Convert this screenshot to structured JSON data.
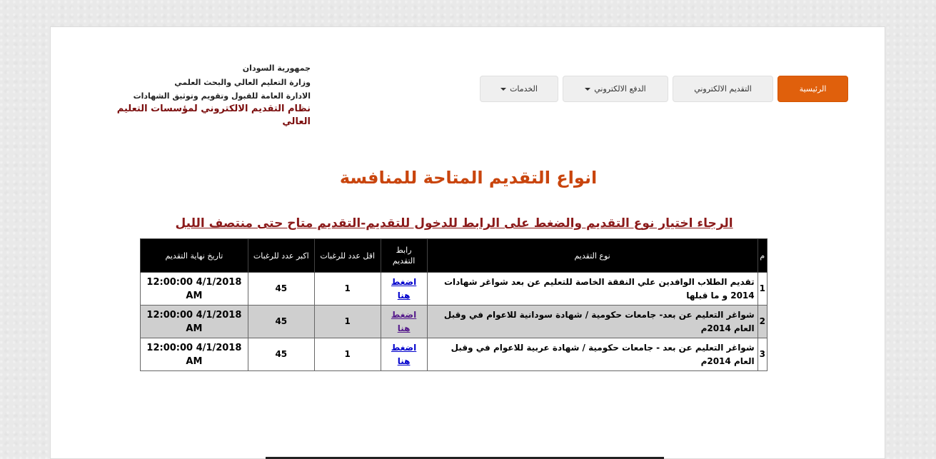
{
  "header": {
    "republic": "جمهورية السودان",
    "ministry": "وزارة التعليم العالي والبحث العلمي",
    "directorate": "الادارة العامة للقبول وتقويم وتوثيق الشهادات",
    "system_name": "نظام التقديم الالكتروني لمؤسسات التعليم العالي"
  },
  "nav": {
    "home": "الرئيسية",
    "apply_online": "التقديم الالكتروني",
    "pay_online": "الدفع الالكتروني",
    "services": "الخدمات"
  },
  "colors": {
    "accent": "#e0600c",
    "title": "#c9450d",
    "subtitle": "#8b1a1a",
    "system_name": "#7b0d0d"
  },
  "main": {
    "title": "انواع التقديم المتاحة للمنافسة",
    "instruction": "الرجاء اختيار نوع التقديم والضغط على الرابط للدخول للتقديم-التقديم متاح حتى منتصف الليل"
  },
  "table": {
    "headers": {
      "num": "م",
      "type": "نوع التقديم",
      "link": "رابط التقديم",
      "min": "اقل عدد للرغبات",
      "max": "اكبر عدد للرغبات",
      "deadline": "تاريخ نهاية التقديم"
    },
    "rows": [
      {
        "num": "1",
        "type": "تقديم الطلاب الوافدين علي النفقة الخاصة للتعليم عن بعد شواغر شهادات 2014 و ما قبلها",
        "link": "اضغط هنا",
        "min": "1",
        "max": "45",
        "deadline": "4/1/2018 12:00:00 AM"
      },
      {
        "num": "2",
        "type": "شواغر التعليم عن بعد- جامعات حكومية / شهادة سودانية للاعوام في وقبل العام 2014م",
        "link": "اضغط هنا",
        "min": "1",
        "max": "45",
        "deadline": "4/1/2018 12:00:00 AM"
      },
      {
        "num": "3",
        "type": "شواغر التعليم عن بعد - جامعات حكومية / شهادة عربية للاعوام في وقبل العام 2014م",
        "link": "اضغط هنا",
        "min": "1",
        "max": "45",
        "deadline": "4/1/2018 12:00:00 AM"
      }
    ]
  }
}
